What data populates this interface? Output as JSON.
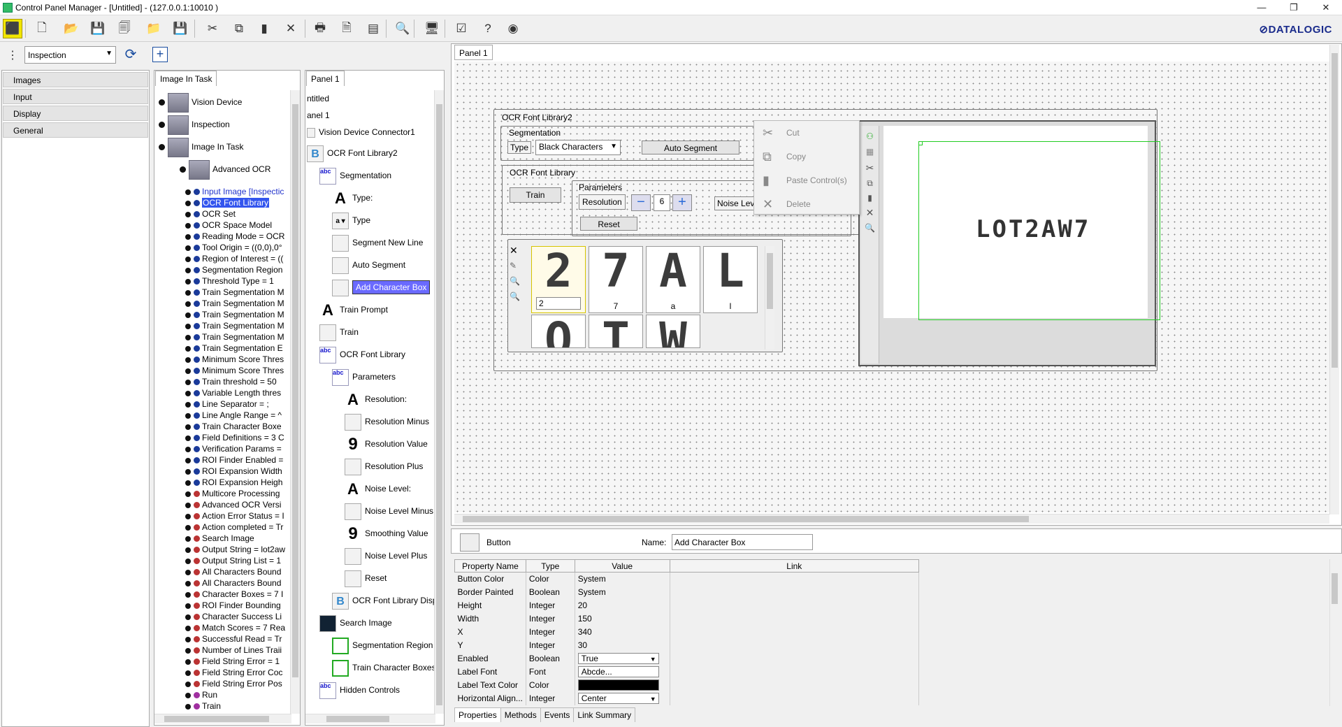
{
  "window": {
    "title": "Control Panel Manager - [Untitled] - (127.0.0.1:10010 )",
    "minimize": "—",
    "restore": "❐",
    "close": "✕",
    "logo": "⊘DATALOGIC"
  },
  "toolbar": {
    "icons": [
      "select-tool-icon",
      "new-file-icon",
      "open-file-icon",
      "save-icon",
      "save-all-icon",
      "open-panel-icon",
      "save-panel-icon",
      "cut-icon",
      "copy-icon",
      "paste-icon",
      "delete-icon",
      "print-icon",
      "print-preview-icon",
      "page-setup-icon",
      "zoom-icon",
      "monitor-icon",
      "checkbox-icon",
      "help-icon",
      "about-icon"
    ],
    "glyphs": [
      "⬛",
      "🗋",
      "📂",
      "💾",
      "🗐",
      "📁",
      "💾",
      "✂",
      "⧉",
      "▮",
      "✕",
      "🖶",
      "🗎",
      "▤",
      "🔍",
      "🖥",
      "☑",
      "?",
      "◉"
    ]
  },
  "inspection": {
    "selected": "Inspection",
    "refresh": "⟳",
    "add": "+"
  },
  "leftnav": {
    "items": [
      "Images",
      "Input",
      "Display",
      "General"
    ]
  },
  "tree1": {
    "tab": "Image In Task",
    "top": [
      {
        "label": "Vision Device"
      },
      {
        "label": "Inspection"
      },
      {
        "label": "Image In Task"
      },
      {
        "label": "Advanced OCR"
      }
    ],
    "items": [
      {
        "label": "Input Image [Inspectic",
        "style": "link"
      },
      {
        "label": "OCR Font Library",
        "style": "hl"
      },
      {
        "label": "OCR Set"
      },
      {
        "label": "OCR Space Model"
      },
      {
        "label": "Reading Mode = OCR"
      },
      {
        "label": "Tool Origin = ((0,0),0°"
      },
      {
        "label": "Region of Interest = (("
      },
      {
        "label": "Segmentation Region"
      },
      {
        "label": "Threshold Type = 1"
      },
      {
        "label": "Train Segmentation M"
      },
      {
        "label": "Train Segmentation M"
      },
      {
        "label": "Train Segmentation M"
      },
      {
        "label": "Train Segmentation M"
      },
      {
        "label": "Train Segmentation M"
      },
      {
        "label": "Train Segmentation E"
      },
      {
        "label": "Minimum Score Thres"
      },
      {
        "label": "Minimum Score Thres"
      },
      {
        "label": "Train threshold = 50"
      },
      {
        "label": "Variable Length thres"
      },
      {
        "label": "Line Separator = ;"
      },
      {
        "label": "Line Angle Range = ^"
      },
      {
        "label": "Train Character Boxe"
      },
      {
        "label": "Field Definitions = 3 C"
      },
      {
        "label": "Verification Params ="
      },
      {
        "label": "ROI Finder Enabled ="
      },
      {
        "label": "ROI Expansion Width"
      },
      {
        "label": "ROI Expansion Heigh"
      },
      {
        "label": "Multicore Processing",
        "dot": "red"
      },
      {
        "label": "Advanced OCR Versi",
        "dot": "red"
      },
      {
        "label": "Action Error Status = I",
        "dot": "red"
      },
      {
        "label": "Action completed = Tr",
        "dot": "red"
      },
      {
        "label": "Search Image",
        "dot": "red"
      },
      {
        "label": "Output String = lot2aw",
        "dot": "red"
      },
      {
        "label": "Output String List = 1",
        "dot": "red"
      },
      {
        "label": "All Characters Bound",
        "dot": "red"
      },
      {
        "label": "All Characters Bound",
        "dot": "red"
      },
      {
        "label": "Character Boxes = 7 I",
        "dot": "red"
      },
      {
        "label": "ROI Finder Bounding",
        "dot": "red"
      },
      {
        "label": "Character Success Li",
        "dot": "red"
      },
      {
        "label": "Match Scores = 7 Rea",
        "dot": "red"
      },
      {
        "label": "Successful Read = Tr",
        "dot": "red"
      },
      {
        "label": "Number of Lines Traii",
        "dot": "red"
      },
      {
        "label": "Field String Error = 1",
        "dot": "red"
      },
      {
        "label": "Field String Error Coc",
        "dot": "red"
      },
      {
        "label": "Field String Error Pos",
        "dot": "red"
      },
      {
        "label": "Run",
        "dot": "pur"
      },
      {
        "label": "Train",
        "dot": "pur"
      }
    ]
  },
  "tree2": {
    "tab": "Panel 1",
    "rows": [
      {
        "label": "ntitled",
        "indent": 0,
        "icon": "none"
      },
      {
        "label": "anel 1",
        "indent": 0,
        "icon": "none"
      },
      {
        "label": "Vision Device Connector1",
        "indent": 0,
        "icon": "vd"
      },
      {
        "label": "OCR Font Library2",
        "indent": 0,
        "icon": "b"
      },
      {
        "label": "Segmentation",
        "indent": 1,
        "icon": "abc"
      },
      {
        "label": "Type:",
        "indent": 2,
        "icon": "A"
      },
      {
        "label": "Type",
        "indent": 2,
        "icon": "combo"
      },
      {
        "label": "Segment New Line",
        "indent": 2,
        "icon": "btn"
      },
      {
        "label": "Auto Segment",
        "indent": 2,
        "icon": "btn"
      },
      {
        "label": "Add Character Box",
        "indent": 2,
        "icon": "btn",
        "sel": true
      },
      {
        "label": "Train Prompt",
        "indent": 1,
        "icon": "A"
      },
      {
        "label": "Train",
        "indent": 1,
        "icon": "btn"
      },
      {
        "label": "OCR Font Library",
        "indent": 1,
        "icon": "abc"
      },
      {
        "label": "Parameters",
        "indent": 2,
        "icon": "abc"
      },
      {
        "label": "Resolution:",
        "indent": 3,
        "icon": "A"
      },
      {
        "label": "Resolution Minus",
        "indent": 3,
        "icon": "btn"
      },
      {
        "label": "Resolution Value",
        "indent": 3,
        "icon": "9"
      },
      {
        "label": "Resolution Plus",
        "indent": 3,
        "icon": "btn"
      },
      {
        "label": "Noise Level:",
        "indent": 3,
        "icon": "A"
      },
      {
        "label": "Noise Level Minus",
        "indent": 3,
        "icon": "btn"
      },
      {
        "label": "Smoothing Value",
        "indent": 3,
        "icon": "9"
      },
      {
        "label": "Noise Level Plus",
        "indent": 3,
        "icon": "btn"
      },
      {
        "label": "Reset",
        "indent": 3,
        "icon": "btn"
      },
      {
        "label": "OCR Font Library Disp",
        "indent": 2,
        "icon": "b"
      },
      {
        "label": "Search Image",
        "indent": 1,
        "icon": "img"
      },
      {
        "label": "Segmentation Region",
        "indent": 2,
        "icon": "region"
      },
      {
        "label": "Train Character Boxes",
        "indent": 2,
        "icon": "region"
      },
      {
        "label": "Hidden Controls",
        "indent": 1,
        "icon": "abc"
      }
    ]
  },
  "canvas": {
    "tab": "Panel 1",
    "ocr_font_library2": "OCR Font Library2",
    "segmentation": "Segmentation",
    "type_label": "Type",
    "type_value": "Black Characters",
    "auto_segment": "Auto Segment",
    "ocr_font_library": "OCR Font Library",
    "parameters": "Parameters",
    "train": "Train",
    "resolution": "Resolution",
    "resolution_value": "6",
    "noise_level": "Noise Lev",
    "reset": "Reset",
    "glyphs": [
      {
        "ch": "2",
        "label": "2",
        "edit": true
      },
      {
        "ch": "7",
        "label": "7"
      },
      {
        "ch": "A",
        "label": "a"
      },
      {
        "ch": "L",
        "label": "l"
      },
      {
        "ch": "O",
        "label": ""
      },
      {
        "ch": "T",
        "label": ""
      },
      {
        "ch": "W",
        "label": ""
      }
    ],
    "ocr_text": "LOT2AW7",
    "context_menu": [
      {
        "label": "Cut",
        "icon": "✂"
      },
      {
        "label": "Copy",
        "icon": "⧉"
      },
      {
        "label": "Paste Control(s)",
        "icon": "▮"
      },
      {
        "label": "Delete",
        "icon": "✕"
      }
    ]
  },
  "properties": {
    "control_type": "Button",
    "name_label": "Name:",
    "name_value": "Add Character Box",
    "headers": [
      "Property Name",
      "Type",
      "Value",
      "Link"
    ],
    "rows": [
      {
        "name": "Button Color",
        "type": "Color",
        "value": "System"
      },
      {
        "name": "Border Painted",
        "type": "Boolean",
        "value": "System"
      },
      {
        "name": "Height",
        "type": "Integer",
        "value": "20"
      },
      {
        "name": "Width",
        "type": "Integer",
        "value": "150"
      },
      {
        "name": "X",
        "type": "Integer",
        "value": "340"
      },
      {
        "name": "Y",
        "type": "Integer",
        "value": "30"
      },
      {
        "name": "Enabled",
        "type": "Boolean",
        "value": "True",
        "kind": "select"
      },
      {
        "name": "Label Font",
        "type": "Font",
        "value": "Abcde...",
        "kind": "box"
      },
      {
        "name": "Label Text Color",
        "type": "Color",
        "value": "",
        "kind": "black"
      },
      {
        "name": "Horizontal Align...",
        "type": "Integer",
        "value": "Center",
        "kind": "select"
      }
    ],
    "tabs": [
      "Properties",
      "Methods",
      "Events",
      "Link Summary"
    ]
  }
}
